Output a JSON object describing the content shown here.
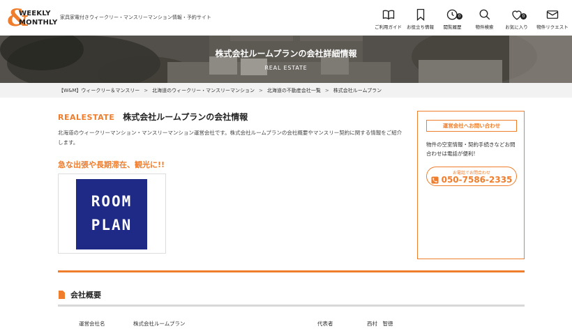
{
  "header": {
    "logo_top": "WEEKLY",
    "logo_bottom": "MONTHLY",
    "tagline": "家具家電付きウィークリー・マンスリーマンション情報・予約サイト",
    "nav": [
      {
        "label": "ご利用ガイド",
        "icon": "book-icon"
      },
      {
        "label": "お役立ち情報",
        "icon": "bookmark-icon"
      },
      {
        "label": "閲覧履歴",
        "icon": "clock-icon",
        "badge": "0"
      },
      {
        "label": "物件検索",
        "icon": "search-icon"
      },
      {
        "label": "お気に入り",
        "icon": "heart-icon",
        "badge": "0"
      },
      {
        "label": "物件リクエスト",
        "icon": "mail-icon"
      }
    ]
  },
  "hero": {
    "title": "株式会社ルームプランの会社詳細情報",
    "subtitle": "REAL ESTATE"
  },
  "breadcrumb": [
    "【W&M】ウィークリー＆マンスリー",
    "北海道のウィークリー・マンスリーマンション",
    "北海道の不動産会社一覧",
    "株式会社ルームプラン"
  ],
  "breadcrumb_sep": ">",
  "main": {
    "section_en": "REALESTATE",
    "section_jp": "株式会社ルームプランの会社情報",
    "description": "北海道のウィークリーマンション・マンスリーマンション運営会社です。株式会社ルームプランの会社概要やマンスリー契約に関する情報をご紹介します。",
    "catch": "急な出張や長期滞在、観光に!!",
    "company_logo": {
      "line1": "ROOM",
      "line2": "PLAN"
    }
  },
  "sidebar": {
    "heading": "運営会社へお問い合わせ",
    "text": "物件の空室情報・契約手続きなどお問合わせは電話が便利!",
    "phone_label": "お電話でお問合わせ",
    "phone_number": "050-7586-2335"
  },
  "company_info": {
    "heading": "会社概要",
    "rows": [
      {
        "label": "運営会社名",
        "value": "株式会社ルームプラン"
      },
      {
        "label": "代表者",
        "value": "西村　智徳"
      }
    ]
  },
  "colors": {
    "accent": "#ef7d2c",
    "logo_navy": "#1e2a86"
  }
}
